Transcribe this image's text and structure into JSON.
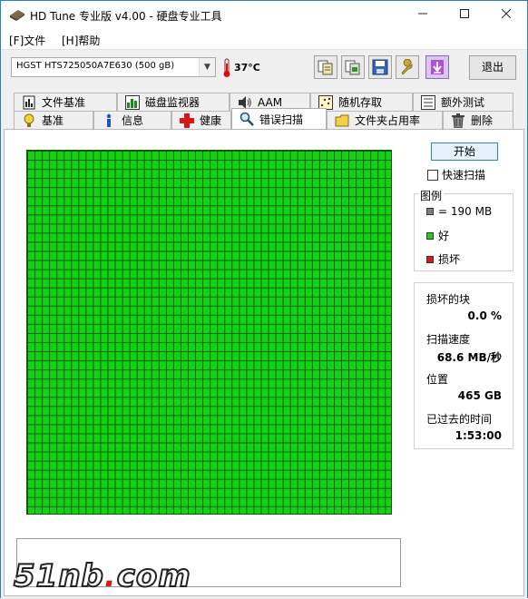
{
  "window": {
    "title": "HD Tune 专业版 v4.00 - 硬盘专业工具"
  },
  "menu": [
    {
      "label": "[F]文件"
    },
    {
      "label": "[H]帮助"
    }
  ],
  "toolbar": {
    "drive": "HGST HTS725050A7E630 (500 gB)",
    "temperature": "37°C",
    "exit_label": "退出"
  },
  "tabs_top": [
    {
      "label": "文件基准",
      "icon": "file-benchmark-icon"
    },
    {
      "label": "磁盘监视器",
      "icon": "disk-monitor-icon"
    },
    {
      "label": "AAM",
      "icon": "speaker-icon"
    },
    {
      "label": "随机存取",
      "icon": "random-access-icon"
    },
    {
      "label": "额外测试",
      "icon": "extra-tests-icon"
    }
  ],
  "tabs_bottom": [
    {
      "label": "基准",
      "icon": "benchmark-icon"
    },
    {
      "label": "信息",
      "icon": "info-icon"
    },
    {
      "label": "健康",
      "icon": "health-icon"
    },
    {
      "label": "错误扫描",
      "icon": "error-scan-icon",
      "active": true
    },
    {
      "label": "文件夹占用率",
      "icon": "folder-usage-icon"
    },
    {
      "label": "删除",
      "icon": "trash-icon"
    }
  ],
  "scan": {
    "start_label": "开始",
    "quick_scan_label": "快速扫描",
    "quick_scan_checked": false,
    "legend": {
      "title": "图例",
      "block_size": "= 190 MB",
      "good": "好",
      "bad": "损坏",
      "colors": {
        "block": "#7f7f7f",
        "good": "#19d219",
        "bad": "#e11616"
      }
    },
    "stats": {
      "damaged_label": "损坏的块",
      "damaged_value": "0.0 %",
      "speed_label": "扫描速度",
      "speed_value": "68.6 MB/秒",
      "position_label": "位置",
      "position_value": "465 GB",
      "elapsed_label": "已过去的时间",
      "elapsed_value": "1:53:00"
    },
    "grid": {
      "columns": 50,
      "rows": 40,
      "state": "good"
    }
  },
  "watermark": {
    "text": "51nb",
    "dot": ".",
    "suffix": "com"
  }
}
